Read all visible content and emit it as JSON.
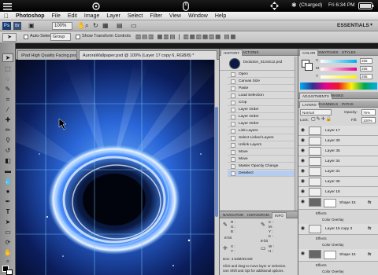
{
  "statusbar": {
    "charging": "(Charged)",
    "clock": "Fri 6:34 PM"
  },
  "menubar": {
    "items": [
      "Photoshop",
      "File",
      "Edit",
      "Image",
      "Layer",
      "Select",
      "Filter",
      "View",
      "Window",
      "Help"
    ]
  },
  "appbar": {
    "zoom": "100%",
    "essentials": "ESSENTIALS"
  },
  "options": {
    "auto_select": "Auto-Select:",
    "group": "Group",
    "show_transform": "Show Transform Controls"
  },
  "document": {
    "tab_inactive": "iPad High Quality Facing.psd",
    "tab_active": "AuroraWallpaper.psd @ 100% (Layer 17 copy 6, RGB/8) *",
    "window_title": "AuroraWallpaper.psd @ 100% (Layer 17 copy 6, RGB/8)"
  },
  "history": {
    "tabs": [
      "HISTORY",
      "ACTIONS"
    ],
    "snapshot": "bsolution_512x512.psd",
    "items": [
      "Open",
      "Canvas Size",
      "Paste",
      "Load Selection",
      "Crop",
      "Layer Order",
      "Layer Order",
      "Layer Order",
      "Link Layers",
      "Select Linked Layers",
      "Unlink Layers",
      "Move",
      "Move",
      "Master Opacity Change",
      "Deselect"
    ]
  },
  "info": {
    "tabs": [
      "NAVIGATOR",
      "HISTOGRAM",
      "INFO"
    ],
    "r": "R :",
    "g": "G :",
    "b": "B :",
    "c": "C :",
    "m": "M :",
    "y": "Y :",
    "k": "K :",
    "bit_left": "8-bit",
    "bit_right": "8-bit",
    "x": "X :",
    "y2": "Y :",
    "w": "W :",
    "h": "H :",
    "doc": "Doc: 4.53M/25.5M",
    "hint1": "Click and drag to move layer or selection.",
    "hint2": "Use Shift and Opt for additional options."
  },
  "color": {
    "tabs": [
      "COLOR",
      "SWATCHES",
      "STYLES"
    ],
    "c_label": "C",
    "m_label": "M",
    "y_label": "Y",
    "value1": "255",
    "value2": "255",
    "value3": "255"
  },
  "adjust": {
    "tabs": [
      "ADJUSTMENTS",
      "MASKS"
    ]
  },
  "layers": {
    "tabs": [
      "LAYERS",
      "CHANNELS",
      "PATHS"
    ],
    "blend": "Normal",
    "opacity_label": "Opacity:",
    "opacity": "75%",
    "lock_label": "Lock:",
    "fill_label": "Fill:",
    "fill": "100%",
    "rows": [
      "Layer 17",
      "Layer 30",
      "Layer 35",
      "Layer 34",
      "Layer 31",
      "Layer 36",
      "Layer 18"
    ],
    "shape1": "Shape 15",
    "effects": "Effects",
    "color_overlay": "Color Overlay",
    "layer15": "Layer 15 copy 3",
    "shape2": "Shape 15",
    "fx": "fx"
  }
}
